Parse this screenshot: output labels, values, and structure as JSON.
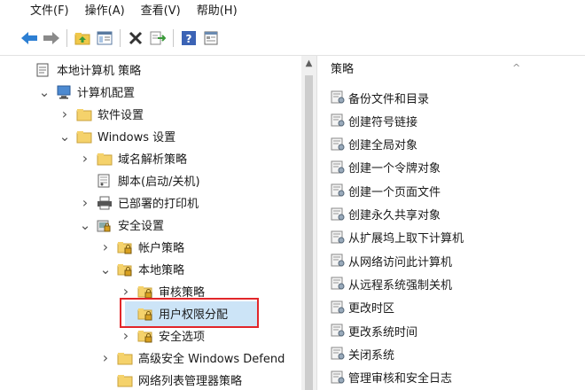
{
  "menu": [
    "文件(F)",
    "操作(A)",
    "查看(V)",
    "帮助(H)"
  ],
  "toolbar_icons": [
    "back-arrow-icon",
    "forward-arrow-icon",
    "up-folder-icon",
    "show-hide-tree-icon",
    "delete-icon",
    "export-list-icon",
    "help-icon",
    "properties-icon"
  ],
  "tree": [
    {
      "label": "本地计算机 策略",
      "indent": 0,
      "arrow": "",
      "icon": "policy-doc-icon"
    },
    {
      "label": "计算机配置",
      "indent": 1,
      "arrow": "expanded",
      "icon": "computer-icon"
    },
    {
      "label": "软件设置",
      "indent": 2,
      "arrow": "collapsed",
      "icon": "folder-icon"
    },
    {
      "label": "Windows 设置",
      "indent": 2,
      "arrow": "expanded",
      "icon": "folder-icon"
    },
    {
      "label": "域名解析策略",
      "indent": 3,
      "arrow": "collapsed",
      "icon": "folder-icon"
    },
    {
      "label": "脚本(启动/关机)",
      "indent": 3,
      "arrow": "",
      "icon": "script-icon"
    },
    {
      "label": "已部署的打印机",
      "indent": 3,
      "arrow": "collapsed",
      "icon": "printer-icon"
    },
    {
      "label": "安全设置",
      "indent": 3,
      "arrow": "expanded",
      "icon": "security-settings-icon"
    },
    {
      "label": "帐户策略",
      "indent": 4,
      "arrow": "collapsed",
      "icon": "lock-folder-icon"
    },
    {
      "label": "本地策略",
      "indent": 4,
      "arrow": "expanded",
      "icon": "lock-folder-icon"
    },
    {
      "label": "审核策略",
      "indent": 5,
      "arrow": "collapsed",
      "icon": "lock-folder-icon"
    },
    {
      "label": "用户权限分配",
      "indent": 5,
      "arrow": "",
      "icon": "lock-folder-icon",
      "selected": true
    },
    {
      "label": "安全选项",
      "indent": 5,
      "arrow": "collapsed",
      "icon": "lock-folder-icon"
    },
    {
      "label": "高级安全 Windows Defend",
      "indent": 4,
      "arrow": "collapsed",
      "icon": "folder-icon"
    },
    {
      "label": "网络列表管理器策略",
      "indent": 4,
      "arrow": "",
      "icon": "folder-icon"
    }
  ],
  "list_header": "策略",
  "policies": [
    "备份文件和目录",
    "创建符号链接",
    "创建全局对象",
    "创建一个令牌对象",
    "创建一个页面文件",
    "创建永久共享对象",
    "从扩展坞上取下计算机",
    "从网络访问此计算机",
    "从远程系统强制关机",
    "更改时区",
    "更改系统时间",
    "关闭系统",
    "管理审核和安全日志"
  ],
  "colors": {
    "selection": "#cce4f7",
    "highlight_box": "#e2262a",
    "folder": "#f5d26b",
    "back_arrow": "#2d7fd3"
  }
}
